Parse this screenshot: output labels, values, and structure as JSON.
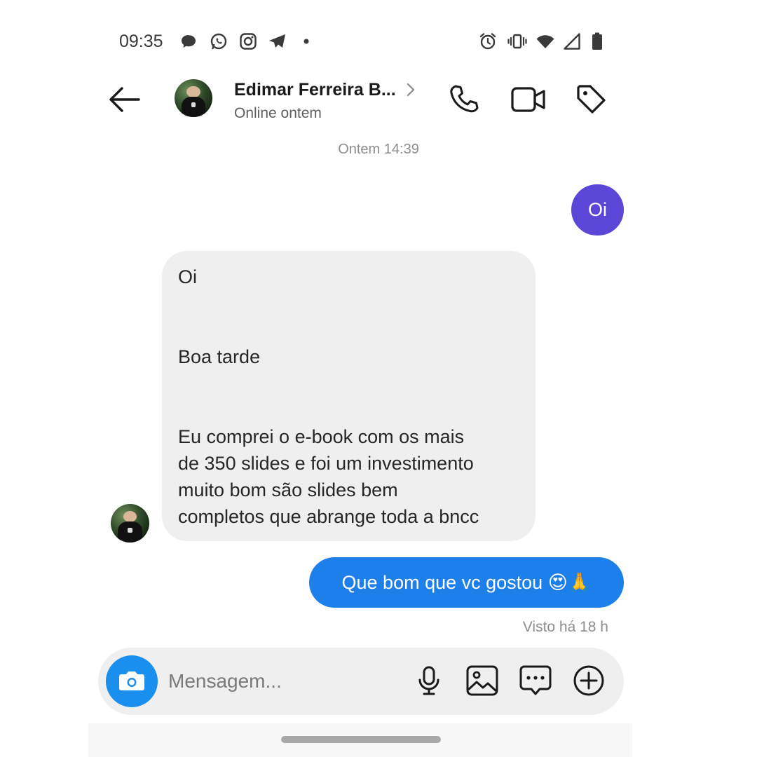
{
  "status_bar": {
    "time": "09:35",
    "left_icons": [
      "chat-bubble-icon",
      "whatsapp-icon",
      "instagram-icon",
      "telegram-icon",
      "dot-icon"
    ],
    "right_icons": [
      "alarm-icon",
      "vibrate-icon",
      "wifi-icon",
      "signal-icon",
      "battery-icon"
    ]
  },
  "header": {
    "contact_name": "Edimar Ferreira B...",
    "contact_status": "Online ontem",
    "icons": [
      "back-arrow-icon",
      "chevron-right-icon",
      "phone-icon",
      "video-camera-icon",
      "tag-icon"
    ]
  },
  "conversation": {
    "timestamp": "Ontem 14:39",
    "messages": [
      {
        "direction": "outgoing",
        "text": "Oi"
      },
      {
        "direction": "incoming",
        "lines": [
          "Oi",
          "Boa tarde",
          "Eu comprei o e-book com os mais",
          "de 350 slides e foi um investimento",
          "muito bom são slides bem",
          "completos que abrange toda a bncc"
        ]
      },
      {
        "direction": "outgoing",
        "text": "Que bom que vc gostou 😍🙏"
      }
    ],
    "seen_status": "Visto há 18 h"
  },
  "composer": {
    "placeholder": "Mensagem...",
    "icons": [
      "camera-icon",
      "microphone-icon",
      "gallery-icon",
      "sticker-chat-icon",
      "plus-circle-icon"
    ]
  },
  "colors": {
    "outgoing_purple": "#5b46d8",
    "outgoing_blue": "#1d80ea",
    "incoming_bubble": "#efefef",
    "camera_button": "#1a8fee"
  }
}
